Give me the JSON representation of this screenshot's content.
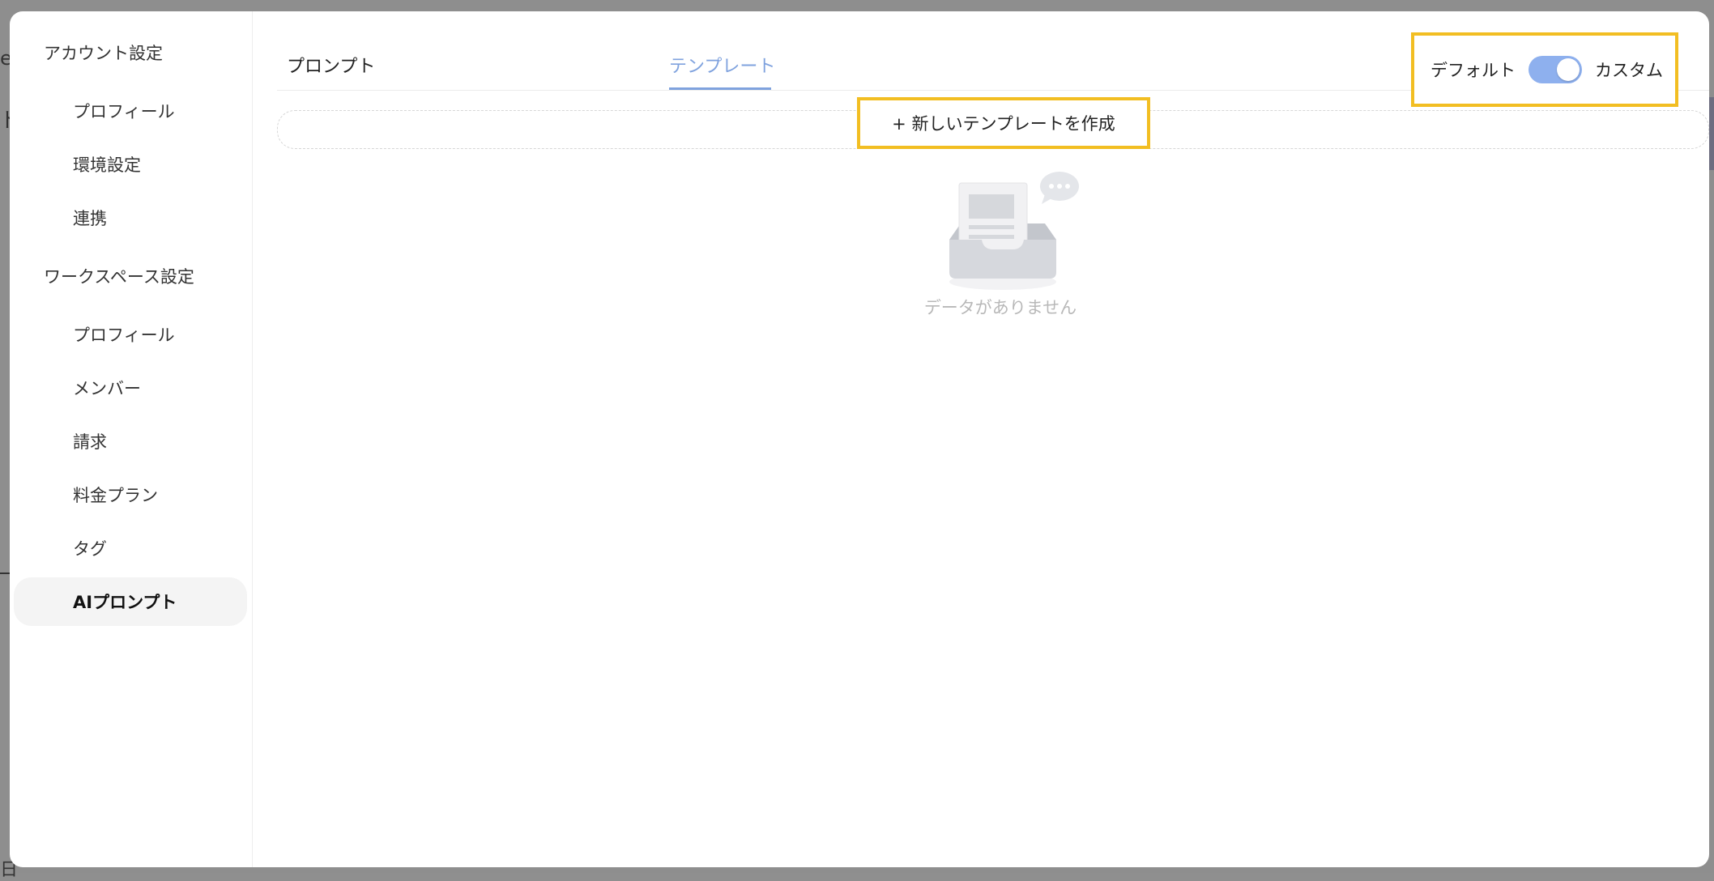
{
  "background": {
    "peek_e": "e",
    "peek_do": "ド",
    "peek_day": "日"
  },
  "sidebar": {
    "account_header": "アカウント設定",
    "account_items": [
      "プロフィール",
      "環境設定",
      "連携"
    ],
    "workspace_header": "ワークスペース設定",
    "workspace_items": [
      "プロフィール",
      "メンバー",
      "請求",
      "料金プラン",
      "タグ",
      "AIプロンプト"
    ],
    "active_item": "AIプロンプト"
  },
  "tabs": [
    {
      "label": "プロンプト",
      "active": false
    },
    {
      "label": "テンプレート",
      "active": true
    }
  ],
  "toggle": {
    "left_label": "デフォルト",
    "right_label": "カスタム",
    "state": "custom"
  },
  "create_button": {
    "label": "+ 新しいテンプレートを作成"
  },
  "empty_state": {
    "text": "データがありません",
    "icon": "empty-inbox-icon"
  },
  "colors": {
    "accent": "#7fa2de",
    "toggle_on": "#8eb0ee",
    "highlight": "#f2be22"
  }
}
